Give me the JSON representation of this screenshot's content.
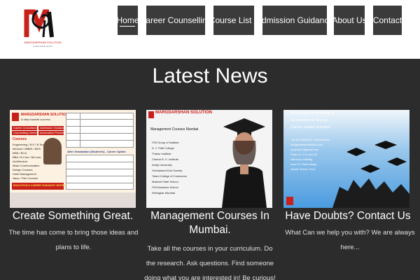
{
  "header": {
    "logo": {
      "brand": "MARGDARSHAN SOLUTION",
      "tagline": "A step towards success",
      "monogram": "M"
    },
    "nav": [
      {
        "label": "Home",
        "active": true
      },
      {
        "label": "Career Counselling",
        "active": false
      },
      {
        "label": "Course List",
        "active": false,
        "has_dropdown": true
      },
      {
        "label": "Admission Guidance",
        "active": false
      },
      {
        "label": "About Us",
        "active": false
      },
      {
        "label": "Contact",
        "active": false
      }
    ],
    "dropdown_icon": "chevron-down-icon"
  },
  "main": {
    "title": "Latest News",
    "cards": [
      {
        "title": "Create Something Great.",
        "text": "The time has come to bring those ideas and plans to life.",
        "image": {
          "brand": "MARGDARSHAN SOLUTION",
          "tagline": "A step towards success",
          "tabs": [
            "Career Consultancy",
            "Admission Guidance",
            "Counselling Center",
            "Information Provider"
          ],
          "courses_heading": "Courses",
          "courses": [
            "Engineering / B.E / B.Tech.",
            "Medical / MBBS / BDS",
            "MBA / BCA",
            "BBA / B.Com / BA Law",
            "Architecture",
            "Mass Communication",
            "Design Courses",
            "Hotel Management",
            "Navy / Film Courses"
          ],
          "section": "After Graduation (Student's) - Career Option",
          "banner": "EDUCATION & CAREER GUIDANCE CENTRE"
        }
      },
      {
        "title": "Management Courses In Mumbai.",
        "text": "Take all the courses in your curriculum. Do the research. Ask questions. Find someone doing what you are interested in! Be curious!",
        "image": {
          "brand": "MARGDARSHAN SOLUTION",
          "heading": "Management Courses Mumbai",
          "colleges": [
            "ITM Group of Institute",
            "D. Y. Patil College",
            "Thakur Institute",
            "Chetna R. K. Institute",
            "Amity University",
            "Vivekanand Edu Society",
            "Tolani College of Commerce",
            "Mukesh Patel School",
            "ITM Business School",
            "Welingkar Mumbai"
          ]
        }
      },
      {
        "title": "Have Doubts? Contact Us",
        "text": "What Can we help you with? We are always here...",
        "image": {
          "lines": [
            "Best career counselling &",
            "Get answer to all your",
            "Career related question"
          ],
          "contact": [
            "+91 9372008333 / 9324444446",
            "margdarshansolution.com",
            "cdnjobs11@gmail.com",
            "Shop no. C-4, sec-32,",
            "Harmony building,",
            "near DY Patil college,",
            "Akurdi, Ravet, Pune"
          ]
        }
      }
    ]
  },
  "colors": {
    "background": "#2c2c2c",
    "nav_bg": "#3b3b3b",
    "header_bg": "#ffffff",
    "brand_red": "#c8201a"
  }
}
